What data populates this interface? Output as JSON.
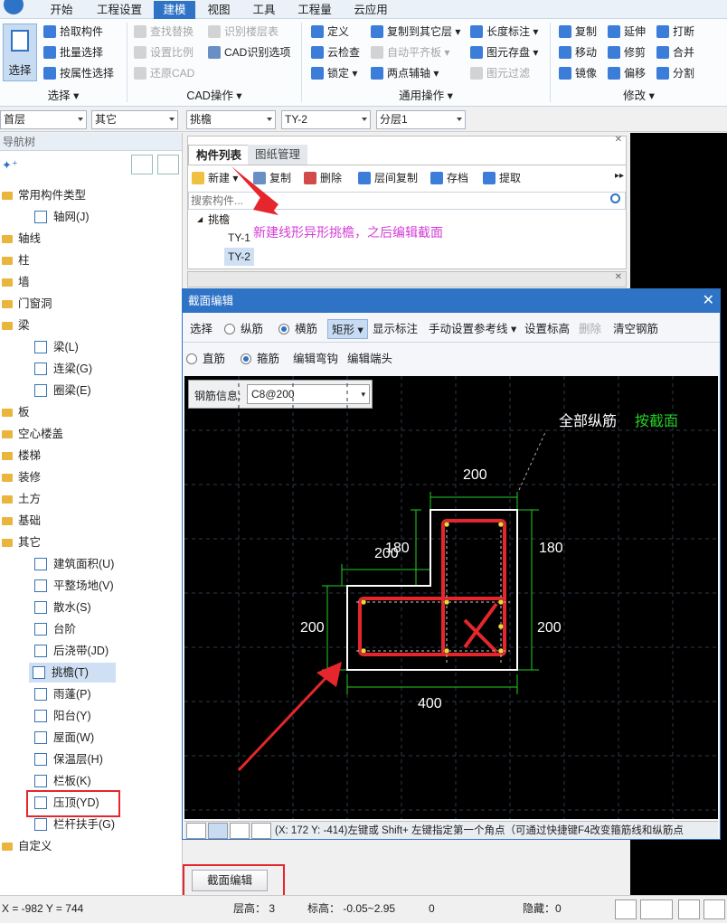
{
  "menu": {
    "items": [
      "开始",
      "工程设置",
      "建模",
      "视图",
      "工具",
      "工程量",
      "云应用"
    ],
    "active_index": 2
  },
  "ribbon": {
    "select_big": "选择",
    "select_group": {
      "items": [
        "拾取构件",
        "批量选择",
        "按属性选择"
      ],
      "title": "选择"
    },
    "cad_group": {
      "items": [
        "查找替换",
        "识别楼层表",
        "设置比例",
        "CAD识别选项",
        "还原CAD"
      ],
      "title": "CAD操作"
    },
    "common_group": {
      "items": [
        "定义",
        "复制到其它层",
        "长度标注",
        "云检查",
        "自动平齐板",
        "图元存盘",
        "锁定",
        "两点辅轴",
        "图元过滤"
      ],
      "title": "通用操作"
    },
    "modify_group": {
      "items": [
        "复制",
        "延伸",
        "打断",
        "移动",
        "修剪",
        "合并",
        "镜像",
        "偏移",
        "分割"
      ],
      "title": "修改"
    },
    "accent": "#2f73c6"
  },
  "combos": [
    "首层",
    "其它",
    "挑檐",
    "TY-2",
    "分层1"
  ],
  "nav": {
    "title": "导航树",
    "nodes": [
      {
        "label": "常用构件类型",
        "type": "folder"
      },
      {
        "label": "轴网(J)",
        "type": "child"
      },
      {
        "label": "轴线",
        "type": "folder"
      },
      {
        "label": "柱",
        "type": "folder"
      },
      {
        "label": "墙",
        "type": "folder"
      },
      {
        "label": "门窗洞",
        "type": "folder"
      },
      {
        "label": "梁",
        "type": "folder"
      },
      {
        "label": "梁(L)",
        "type": "child"
      },
      {
        "label": "连梁(G)",
        "type": "child"
      },
      {
        "label": "圈梁(E)",
        "type": "child"
      },
      {
        "label": "板",
        "type": "folder"
      },
      {
        "label": "空心楼盖",
        "type": "folder"
      },
      {
        "label": "楼梯",
        "type": "folder"
      },
      {
        "label": "装修",
        "type": "folder"
      },
      {
        "label": "土方",
        "type": "folder"
      },
      {
        "label": "基础",
        "type": "folder"
      },
      {
        "label": "其它",
        "type": "folder"
      },
      {
        "label": "建筑面积(U)",
        "type": "child"
      },
      {
        "label": "平整场地(V)",
        "type": "child"
      },
      {
        "label": "散水(S)",
        "type": "child"
      },
      {
        "label": "台阶",
        "type": "child"
      },
      {
        "label": "后浇带(JD)",
        "type": "child"
      },
      {
        "label": "挑檐(T)",
        "type": "child",
        "selected": true
      },
      {
        "label": "雨蓬(P)",
        "type": "child"
      },
      {
        "label": "阳台(Y)",
        "type": "child"
      },
      {
        "label": "屋面(W)",
        "type": "child"
      },
      {
        "label": "保温层(H)",
        "type": "child"
      },
      {
        "label": "栏板(K)",
        "type": "child"
      },
      {
        "label": "压顶(YD)",
        "type": "child"
      },
      {
        "label": "栏杆扶手(G)",
        "type": "child"
      },
      {
        "label": "自定义",
        "type": "folder"
      }
    ]
  },
  "cplist": {
    "tabs": [
      "构件列表",
      "图纸管理"
    ],
    "toolbar": [
      "新建",
      "复制",
      "删除",
      "层间复制",
      "存档",
      "提取"
    ],
    "search_placeholder": "搜索构件...",
    "tree_root": "挑檐",
    "items": [
      "TY-1",
      "TY-2"
    ],
    "annotation": "新建线形异形挑檐，之后编辑截面"
  },
  "dialog": {
    "title": "截面编辑",
    "row1": {
      "select": "选择",
      "opt1": "纵筋",
      "opt2": "横筋",
      "shape": "矩形",
      "show": "显示标注",
      "ref": "手动设置参考线",
      "elev": "设置标高",
      "del": "删除",
      "clear": "清空钢筋"
    },
    "row2": {
      "opt1": "直筋",
      "opt2": "箍筋",
      "hook": "编辑弯钩",
      "end": "编辑端头"
    },
    "rebar_label": "钢筋信息:",
    "rebar_value": "C8@200",
    "canvas_note_white": "全部纵筋",
    "canvas_note_green": "按截面",
    "dims": {
      "top": "200",
      "left_upper": "180",
      "left_upper2": "200",
      "right_upper": "180",
      "left_lower": "200",
      "right_lower": "200",
      "bottom": "400"
    },
    "status": "(X: 172 Y: -414)左键或 Shift+ 左键指定第一个角点（可通过快捷键F4改变箍筋线和纵筋点"
  },
  "section_button": "截面编辑",
  "statusbar": {
    "coords": "X = -982 Y = 744",
    "floor_h": "层高：  3",
    "elev": "标高：  -0.05~2.95",
    "zero": "0",
    "hidden": "隐藏：0"
  }
}
